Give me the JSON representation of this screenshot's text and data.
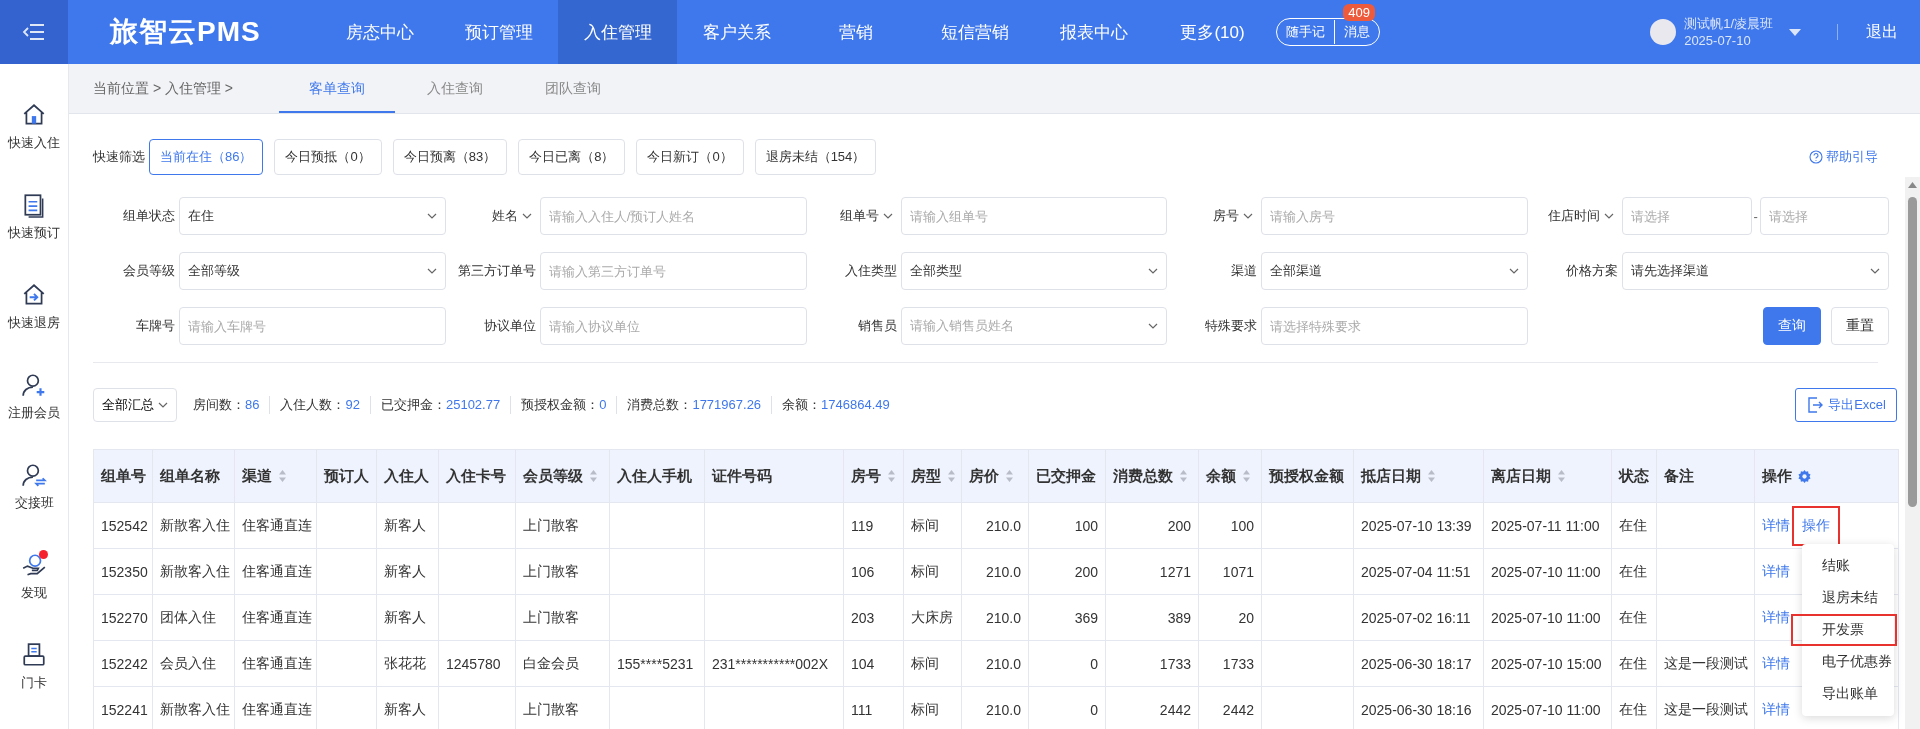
{
  "header": {
    "logo": "旅智云PMS",
    "nav": [
      {
        "label": "房态中心",
        "selected": false
      },
      {
        "label": "预订管理",
        "selected": false
      },
      {
        "label": "入住管理",
        "selected": true
      },
      {
        "label": "客户关系",
        "selected": false
      },
      {
        "label": "营销",
        "selected": false
      },
      {
        "label": "短信营销",
        "selected": false
      },
      {
        "label": "报表中心",
        "selected": false
      },
      {
        "label": "更多(10)",
        "selected": false
      }
    ],
    "notes": "随手记",
    "messages": "消息",
    "message_count": "409",
    "user": {
      "name": "测试帆1/凌晨班",
      "date": "2025-07-10"
    },
    "logout": "退出"
  },
  "sidebar": [
    {
      "label": "快速入住",
      "dot": false
    },
    {
      "label": "快速预订",
      "dot": false
    },
    {
      "label": "快速退房",
      "dot": false
    },
    {
      "label": "注册会员",
      "dot": false
    },
    {
      "label": "交接班",
      "dot": false
    },
    {
      "label": "发现",
      "dot": true
    },
    {
      "label": "门卡",
      "dot": false
    }
  ],
  "breadcrumb": "当前位置 > 入住管理 >",
  "tabs": [
    {
      "label": "客单查询",
      "selected": true
    },
    {
      "label": "入住查询",
      "selected": false
    },
    {
      "label": "团队查询",
      "selected": false
    }
  ],
  "quick_filter": {
    "label": "快速筛选",
    "chips": [
      {
        "label": "当前在住（86）",
        "selected": true
      },
      {
        "label": "今日预抵（0）",
        "selected": false
      },
      {
        "label": "今日预离（83）",
        "selected": false
      },
      {
        "label": "今日已离（8）",
        "selected": false
      },
      {
        "label": "今日新订（0）",
        "selected": false
      },
      {
        "label": "退房未结（154）",
        "selected": false
      }
    ]
  },
  "help": "帮助引导",
  "form": [
    [
      {
        "kind": "select",
        "label": "组单状态",
        "value": "在住"
      },
      {
        "kind": "input",
        "label": "姓名",
        "label_dropdown": true,
        "placeholder": "请输入入住人/预订人姓名"
      },
      {
        "kind": "input",
        "label": "组单号",
        "label_dropdown": true,
        "placeholder": "请输入组单号"
      },
      {
        "kind": "input",
        "label": "房号",
        "label_dropdown": true,
        "placeholder": "请输入房号"
      },
      {
        "kind": "range",
        "label": "住店时间",
        "label_dropdown": true,
        "from_placeholder": "请选择",
        "separator": "-",
        "to_placeholder": "请选择"
      }
    ],
    [
      {
        "kind": "select",
        "label": "会员等级",
        "value": "全部等级"
      },
      {
        "kind": "input",
        "label": "第三方订单号",
        "placeholder": "请输入第三方订单号"
      },
      {
        "kind": "select",
        "label": "入住类型",
        "value": "全部类型"
      },
      {
        "kind": "select",
        "label": "渠道",
        "value": "全部渠道"
      },
      {
        "kind": "select",
        "label": "价格方案",
        "value": "请先选择渠道"
      }
    ],
    [
      {
        "kind": "input",
        "label": "车牌号",
        "placeholder": "请输入车牌号"
      },
      {
        "kind": "input",
        "label": "协议单位",
        "placeholder": "请输入协议单位"
      },
      {
        "kind": "select",
        "label": "销售员",
        "placeholder": "请输入销售员姓名"
      },
      {
        "kind": "input",
        "label": "特殊要求",
        "placeholder": "请选择特殊要求"
      },
      {
        "kind": "buttons",
        "buttons": [
          {
            "label": "查询",
            "primary": true
          },
          {
            "label": "重置",
            "primary": false
          }
        ]
      }
    ]
  ],
  "summary": {
    "scope": "全部汇总",
    "stats": [
      {
        "label": "房间数：",
        "value": "86"
      },
      {
        "label": "入住人数：",
        "value": "92"
      },
      {
        "label": "已交押金：",
        "value": "25102.77"
      },
      {
        "label": "预授权金额：",
        "value": "0"
      },
      {
        "label": "消费总数：",
        "value": "1771967.26"
      },
      {
        "label": "余额：",
        "value": "1746864.49"
      }
    ],
    "export": "导出Excel"
  },
  "table": {
    "columns": [
      {
        "label": "组单号",
        "kind": "text",
        "sortable": false
      },
      {
        "label": "组单名称",
        "kind": "text",
        "sortable": false
      },
      {
        "label": "渠道",
        "kind": "text",
        "sortable": true
      },
      {
        "label": "预订人",
        "kind": "text",
        "sortable": false
      },
      {
        "label": "入住人",
        "kind": "text",
        "sortable": false
      },
      {
        "label": "入住卡号",
        "kind": "text",
        "sortable": false
      },
      {
        "label": "会员等级",
        "kind": "text",
        "sortable": true
      },
      {
        "label": "入住人手机",
        "kind": "text",
        "sortable": false
      },
      {
        "label": "证件号码",
        "kind": "text",
        "sortable": false
      },
      {
        "label": "房号",
        "kind": "text",
        "sortable": true
      },
      {
        "label": "房型",
        "kind": "text",
        "sortable": true
      },
      {
        "label": "房价",
        "kind": "number",
        "sortable": true
      },
      {
        "label": "已交押金",
        "kind": "number",
        "sortable": false
      },
      {
        "label": "消费总数",
        "kind": "number",
        "sortable": true
      },
      {
        "label": "余额",
        "kind": "number",
        "sortable": true
      },
      {
        "label": "预授权金额",
        "kind": "number",
        "sortable": false
      },
      {
        "label": "抵店日期",
        "kind": "text",
        "sortable": true
      },
      {
        "label": "离店日期",
        "kind": "text",
        "sortable": true
      },
      {
        "label": "状态",
        "kind": "text",
        "sortable": false
      },
      {
        "label": "备注",
        "kind": "text",
        "sortable": false
      },
      {
        "label": "操作",
        "kind": "actions",
        "sortable": false
      }
    ],
    "rows": [
      {
        "group_no": "152542",
        "group_name": "新散客入住",
        "channel": "住客通直连",
        "guest": "新客人",
        "member_level": "上门散客",
        "room_no": "119",
        "room_type": "标间",
        "rate": "210.0",
        "deposit": "100",
        "consumption": "200",
        "balance": "100",
        "arrival": "2025-07-10 13:39",
        "departure": "2025-07-11 11:00",
        "status": "在住",
        "actions": [
          {
            "label": "详情",
            "highlighted": false
          },
          {
            "label": "操作",
            "highlighted": true
          }
        ]
      },
      {
        "group_no": "152350",
        "group_name": "新散客入住",
        "channel": "住客通直连",
        "guest": "新客人",
        "member_level": "上门散客",
        "room_no": "106",
        "room_type": "标间",
        "rate": "210.0",
        "deposit": "200",
        "consumption": "1271",
        "balance": "1071",
        "arrival": "2025-07-04 11:51",
        "departure": "2025-07-10 11:00",
        "status": "在住",
        "actions": [
          {
            "label": "详情",
            "highlighted": false
          }
        ]
      },
      {
        "group_no": "152270",
        "group_name": "团体入住",
        "channel": "住客通直连",
        "guest": "新客人",
        "member_level": "上门散客",
        "room_no": "203",
        "room_type": "大床房",
        "rate": "210.0",
        "deposit": "369",
        "consumption": "389",
        "balance": "20",
        "arrival": "2025-07-02 16:11",
        "departure": "2025-07-10 11:00",
        "status": "在住",
        "actions": [
          {
            "label": "详情",
            "highlighted": false
          }
        ]
      },
      {
        "group_no": "152242",
        "group_name": "会员入住",
        "channel": "住客通直连",
        "guest": "张花花",
        "card_no": "1245780",
        "member_level": "白金会员",
        "guest_phone": "155****5231",
        "id_no": "231***********002X",
        "room_no": "104",
        "room_type": "标间",
        "rate": "210.0",
        "deposit": "0",
        "consumption": "1733",
        "balance": "1733",
        "arrival": "2025-06-30 18:17",
        "departure": "2025-07-10 15:00",
        "status": "在住",
        "remark": "这是一段测试",
        "actions": [
          {
            "label": "详情",
            "highlighted": false
          }
        ]
      },
      {
        "group_no": "152241",
        "group_name": "新散客入住",
        "channel": "住客通直连",
        "guest": "新客人",
        "member_level": "上门散客",
        "room_no": "111",
        "room_type": "标间",
        "rate": "210.0",
        "deposit": "0",
        "consumption": "2442",
        "balance": "2442",
        "arrival": "2025-06-30 18:16",
        "departure": "2025-07-10 11:00",
        "status": "在住",
        "remark": "这是一段测试",
        "actions": [
          {
            "label": "详情",
            "highlighted": false
          }
        ]
      }
    ]
  },
  "action_menu": [
    {
      "label": "结账",
      "highlighted": false
    },
    {
      "label": "退房未结",
      "highlighted": false
    },
    {
      "label": "开发票",
      "highlighted": true
    },
    {
      "label": "电子优惠券",
      "highlighted": false
    },
    {
      "label": "导出账单",
      "highlighted": false
    }
  ]
}
